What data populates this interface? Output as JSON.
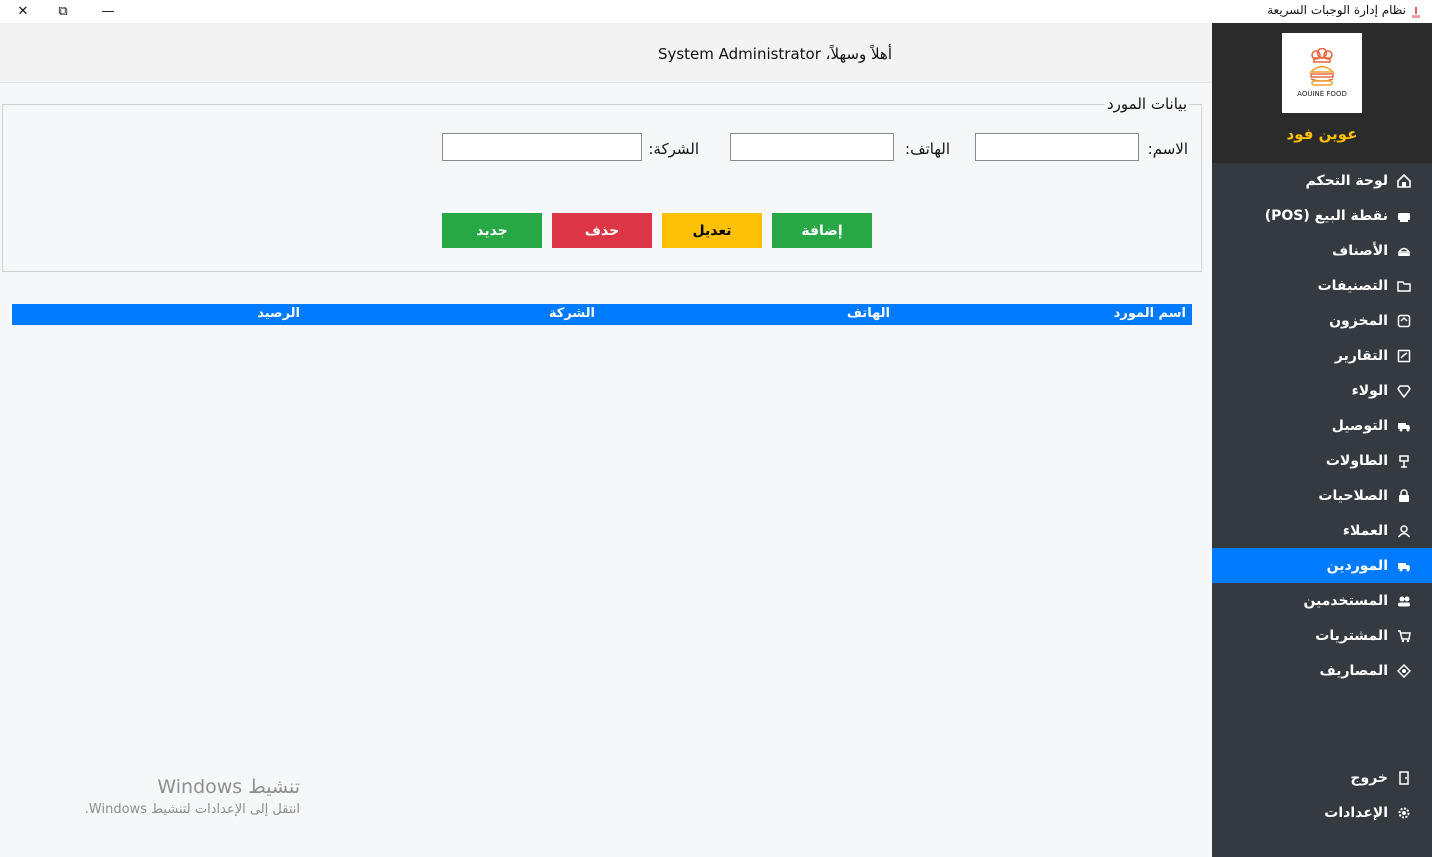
{
  "window": {
    "title": "نظام إدارة الوجبات السريعة",
    "close_glyph": "✕",
    "maximize_glyph": "⧉",
    "minimize_glyph": "—"
  },
  "sidebar": {
    "logo_text": "AOUINE FOOD",
    "brand_name": "عوين فود",
    "brand_color": "#ffc107",
    "items": [
      {
        "label": "لوحة التحكم",
        "icon": "dashboard-icon"
      },
      {
        "label": "نقطة البيع (POS)",
        "icon": "pos-icon"
      },
      {
        "label": "الأصناف",
        "icon": "items-icon"
      },
      {
        "label": "التصنيفات",
        "icon": "folder-icon"
      },
      {
        "label": "المخزون",
        "icon": "inventory-icon"
      },
      {
        "label": "التقارير",
        "icon": "reports-icon"
      },
      {
        "label": "الولاء",
        "icon": "diamond-icon"
      },
      {
        "label": "التوصيل",
        "icon": "truck-icon"
      },
      {
        "label": "الطاولات",
        "icon": "table-icon"
      },
      {
        "label": "الصلاحيات",
        "icon": "lock-icon"
      },
      {
        "label": "العملاء",
        "icon": "customer-icon"
      },
      {
        "label": "الموردين",
        "icon": "truck-icon",
        "active": true
      },
      {
        "label": "المستخدمين",
        "icon": "users-icon"
      },
      {
        "label": "المشتريات",
        "icon": "cart-icon"
      },
      {
        "label": "المصاريف",
        "icon": "expenses-icon"
      }
    ],
    "footer_items": [
      {
        "label": "خروج",
        "icon": "door-icon"
      },
      {
        "label": "الإعدادات",
        "icon": "gear-icon"
      }
    ],
    "active_color": "#007bff"
  },
  "header": {
    "welcome": "أهلاً وسهلاً، System Administrator"
  },
  "form": {
    "legend": "بيانات المورد",
    "name_label": "الاسم:",
    "name_value": "",
    "phone_label": "الهاتف:",
    "phone_value": "",
    "company_label": "الشركة:",
    "company_value": "",
    "buttons": {
      "add": "إضافة",
      "edit": "تعديل",
      "delete": "حذف",
      "new": "جديد"
    }
  },
  "table": {
    "columns": [
      "اسم المورد",
      "الهاتف",
      "الشركة",
      "الرصيد"
    ],
    "rows": []
  },
  "watermark": {
    "line1": "تنشيط Windows",
    "line2": "انتقل إلى الإعدادات لتنشيط Windows."
  }
}
